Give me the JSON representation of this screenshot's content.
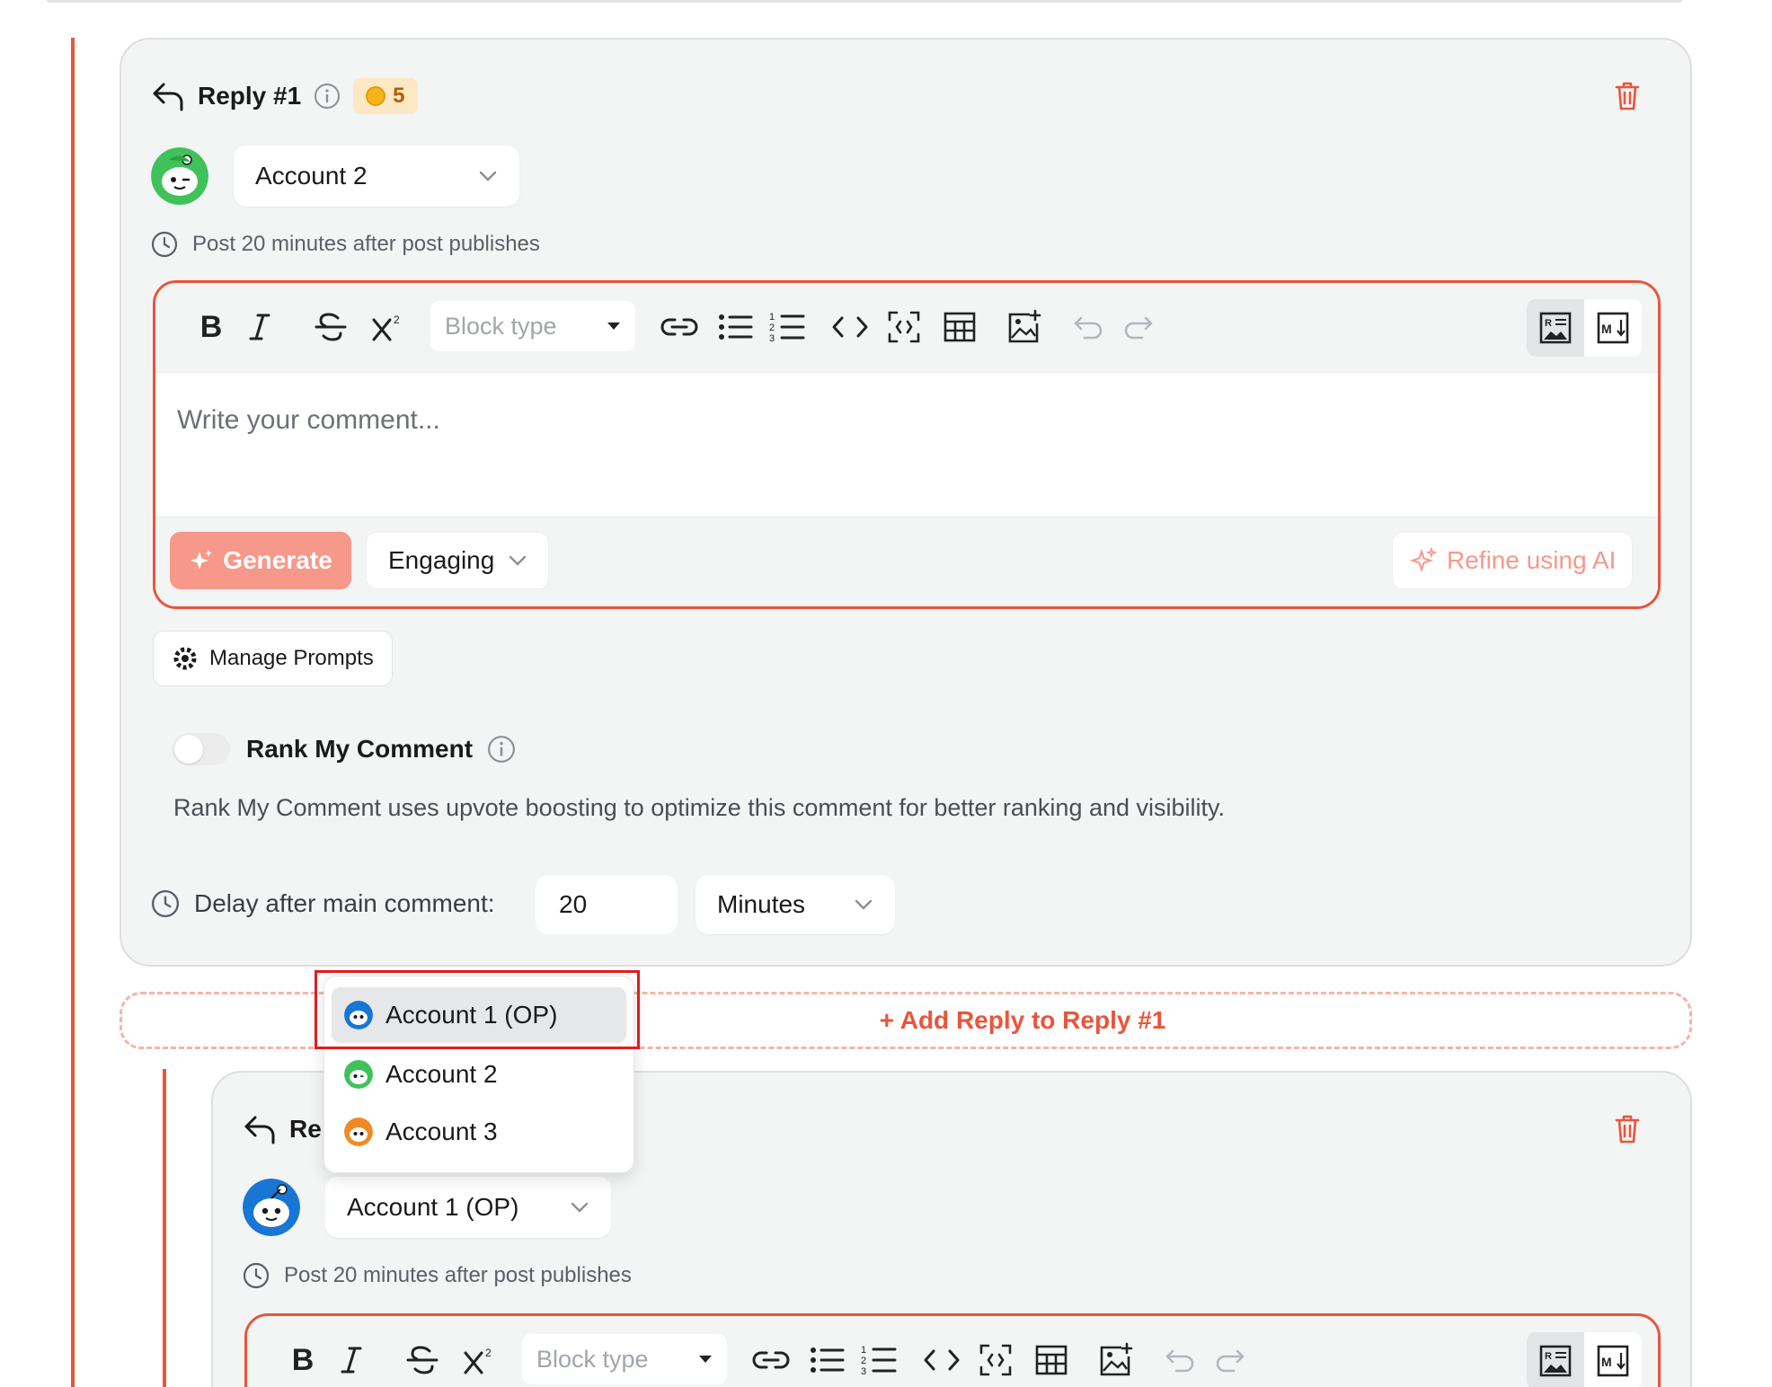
{
  "reply1": {
    "title": "Reply #1",
    "credits": "5",
    "account": "Account 2",
    "schedule": "Post 20 minutes after post publishes",
    "editor": {
      "block_type_placeholder": "Block type",
      "comment_placeholder": "Write your comment...",
      "generate_label": "Generate",
      "tone": "Engaging",
      "refine_label": "Refine using AI"
    },
    "manage_prompts_label": "Manage Prompts",
    "rank_label": "Rank My Comment",
    "rank_description": "Rank My Comment uses upvote boosting to optimize this comment for better ranking and visibility.",
    "delay_label": "Delay after main comment:",
    "delay_value": "20",
    "delay_unit": "Minutes"
  },
  "add_reply_label": "+ Add Reply to Reply #1",
  "account_dropdown": {
    "options": [
      "Account 1 (OP)",
      "Account 2",
      "Account 3"
    ],
    "highlighted": "Account 1 (OP)"
  },
  "reply2": {
    "title_partial": "Re",
    "account": "Account 1 (OP)",
    "schedule": "Post 20 minutes after post publishes",
    "editor": {
      "block_type_placeholder": "Block type"
    }
  },
  "toolbar_icons": [
    "bold-icon",
    "italic-icon",
    "strikethrough-icon",
    "superscript-icon",
    "link-icon",
    "bullet-list-icon",
    "numbered-list-icon",
    "code-icon",
    "code-block-icon",
    "table-icon",
    "image-icon",
    "undo-icon",
    "redo-icon",
    "rich-text-view-icon",
    "markdown-view-icon"
  ],
  "colors": {
    "accent": "#e9553b",
    "generate_bg": "#f6988a",
    "card_bg": "#f3f4f4",
    "highlight_box": "#e11d1d",
    "avatar_green": "#3fc25a",
    "avatar_blue": "#1877d4",
    "avatar_orange": "#f08a24"
  }
}
